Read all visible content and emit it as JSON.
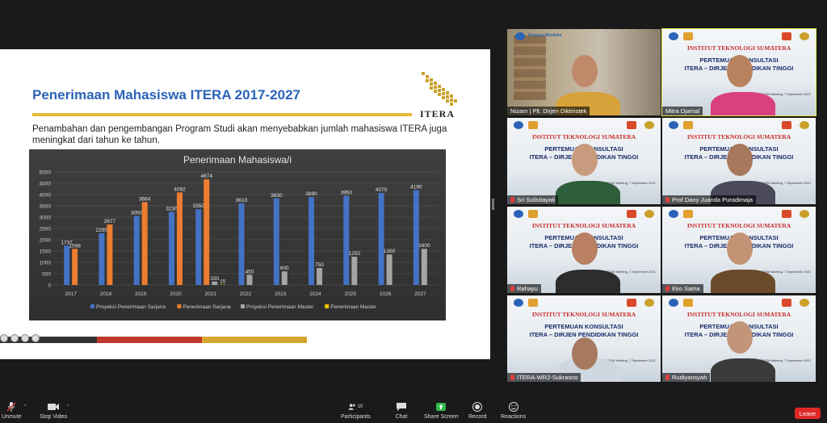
{
  "slide": {
    "title": "Penerimaan Mahasiswa ITERA 2017-2027",
    "logo_text": "ITERA",
    "description": "Penambahan dan pengembangan Program Studi akan menyebabkan jumlah mahasiswa ITERA juga meningkat dari tahun ke tahun.",
    "colors": {
      "title": "#2a63b8",
      "underline": "#e7b93a"
    }
  },
  "chart_data": {
    "type": "bar",
    "title": "Penerimaan Mahasiswa/i",
    "categories": [
      "2017",
      "2018",
      "2019",
      "2020",
      "2021",
      "2022",
      "2023",
      "2024",
      "2025",
      "2026",
      "2027"
    ],
    "ylim": [
      0,
      5000
    ],
    "yticks": [
      0,
      500,
      1000,
      1500,
      2000,
      2500,
      3000,
      3500,
      4000,
      4500,
      5000
    ],
    "legend_position": "bottom",
    "series": [
      {
        "name": "Proyeksi Penerimaan Sarjana",
        "color": "#4472c4",
        "values": [
          1737,
          2290,
          3050,
          3230,
          3350,
          3610,
          3830,
          3890,
          3950,
          4070,
          4190
        ]
      },
      {
        "name": "Penerimaan Sarjana",
        "color": "#ed7d31",
        "values": [
          1598,
          2677,
          3664,
          4092,
          4674,
          null,
          null,
          null,
          null,
          null,
          null
        ]
      },
      {
        "name": "Proyeksi Penerimaan Master",
        "color": "#a5a5a5",
        "values": [
          null,
          null,
          null,
          null,
          150,
          450,
          600,
          750,
          1250,
          1350,
          1600
        ]
      },
      {
        "name": "Penerimaan Master",
        "color": "#ffc000",
        "values": [
          null,
          null,
          null,
          null,
          15,
          null,
          null,
          null,
          null,
          null,
          null
        ]
      }
    ]
  },
  "participants": [
    {
      "name": "Nizam | Plt. Dirjen Diktiristek",
      "background": "office"
    },
    {
      "name": "Mitra Djamal",
      "background": "itera",
      "active": true
    },
    {
      "name": "Sri Sulistiayati",
      "background": "itera"
    },
    {
      "name": "Prof Dany Juanda Puradimaja",
      "background": "itera"
    },
    {
      "name": "Rahayu",
      "background": "itera"
    },
    {
      "name": "Eko Satria",
      "background": "itera"
    },
    {
      "name": "ITERA-WR2-Sukrasno",
      "background": "itera2"
    },
    {
      "name": "Rudiyansyah",
      "background": "itera"
    }
  ],
  "virtual_bg": {
    "logo_kampus": "Kampus Merdeka",
    "heading": "INSTITUT TEKNOLOGI SUMATERA",
    "line1": "PERTEMUAN KONSULTASI",
    "line2": "ITERA – DIRJEN PENDIDIKAN TINGGI",
    "date": "ZOOM Meeting, 7 September 2021"
  },
  "toolbar": {
    "unmute": "Unmute",
    "stop_video": "Stop Video",
    "participants": "Participants",
    "participants_count": "10",
    "chat": "Chat",
    "share_screen": "Share Screen",
    "record": "Record",
    "reactions": "Reactions",
    "leave": "Leave",
    "colors": {
      "share": "#2fb84a",
      "leave": "#e02828"
    }
  }
}
